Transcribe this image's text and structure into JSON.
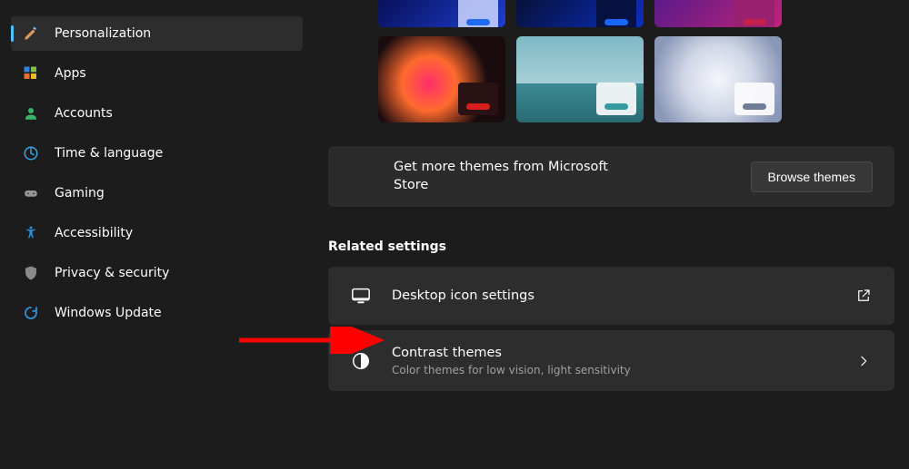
{
  "sidebar": {
    "items": [
      {
        "label": "Personalization",
        "icon": "brush-icon",
        "selected": true
      },
      {
        "label": "Apps",
        "icon": "apps-icon",
        "selected": false
      },
      {
        "label": "Accounts",
        "icon": "person-icon",
        "selected": false
      },
      {
        "label": "Time & language",
        "icon": "clock-globe-icon",
        "selected": false
      },
      {
        "label": "Gaming",
        "icon": "gamepad-icon",
        "selected": false
      },
      {
        "label": "Accessibility",
        "icon": "accessibility-icon",
        "selected": false
      },
      {
        "label": "Privacy & security",
        "icon": "shield-icon",
        "selected": false
      },
      {
        "label": "Windows Update",
        "icon": "update-icon",
        "selected": false
      }
    ]
  },
  "themes": {
    "more_themes_text": "Get more themes from Microsoft Store",
    "browse_button": "Browse themes"
  },
  "related": {
    "header": "Related settings",
    "items": [
      {
        "title": "Desktop icon settings",
        "subtitle": "",
        "icon": "monitor-icon",
        "action": "popout-icon"
      },
      {
        "title": "Contrast themes",
        "subtitle": "Color themes for low vision, light sensitivity",
        "icon": "contrast-icon",
        "action": "chevron-right-icon"
      }
    ]
  }
}
